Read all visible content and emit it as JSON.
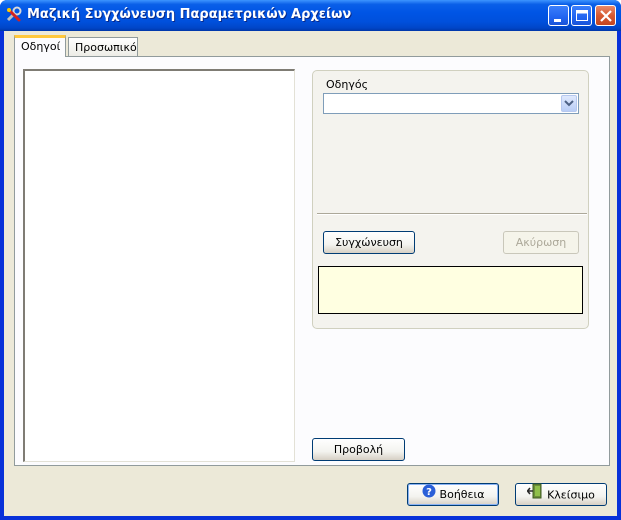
{
  "window": {
    "title": "Μαζική Συγχώνευση Παραμετρικών Αρχείων",
    "app_icon": "tools-icon",
    "controls": [
      "minimize-icon",
      "maximize-icon",
      "close-icon"
    ]
  },
  "tabs": [
    {
      "label": "Οδηγοί",
      "active": true
    },
    {
      "label": "Προσωπικό",
      "active": false
    }
  ],
  "drivers_panel": {
    "driver_label": "Οδηγός",
    "driver_value": "",
    "merge_label": "Συγχώνευση",
    "cancel_label": "Ακύρωση",
    "status_text": ""
  },
  "view_label": "Προβολή",
  "footer": {
    "help_label": "Βοήθεια",
    "close_label": "Κλείσιμο"
  },
  "colors": {
    "title_bar": "#0055e5",
    "window_bg": "#ece9d8",
    "status_bg": "#ffffe1",
    "tab_accent": "#ffc83c"
  }
}
